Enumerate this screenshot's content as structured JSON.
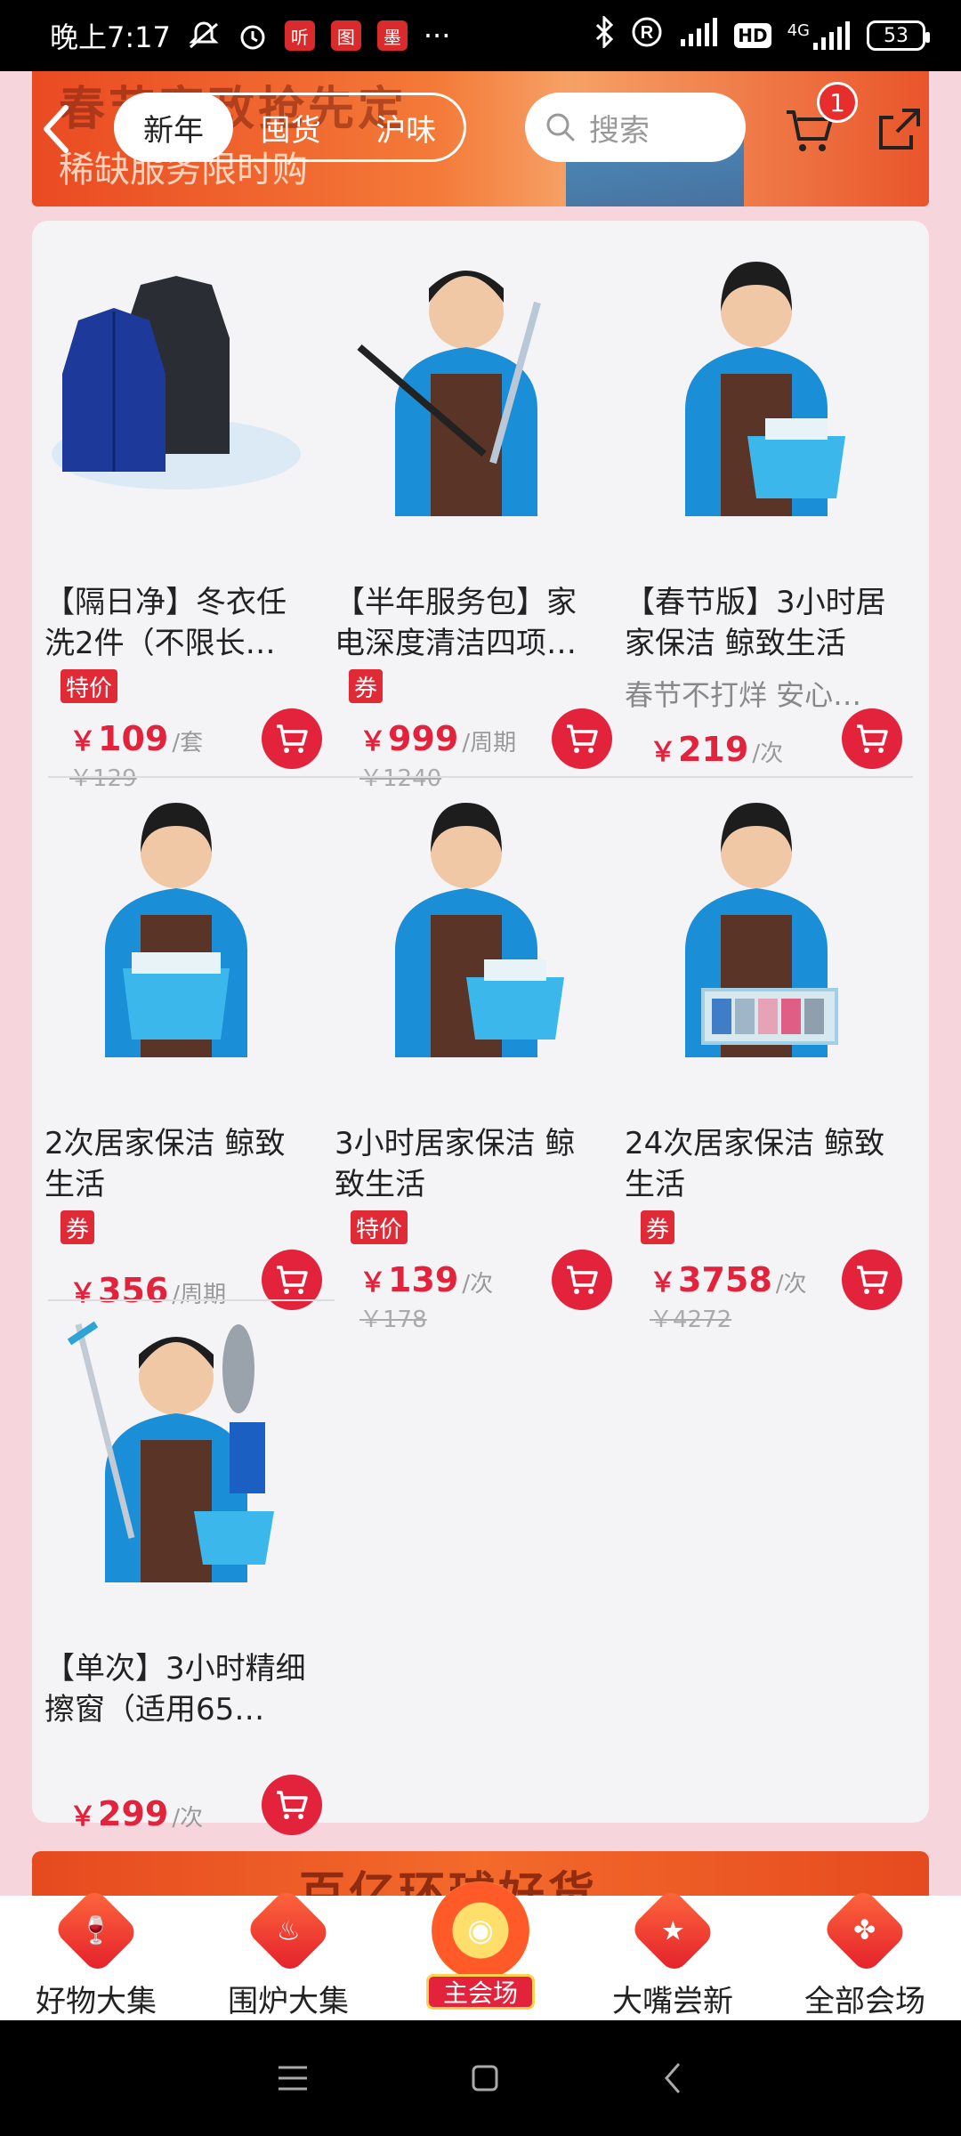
{
  "status_bar": {
    "time": "晚上7:17",
    "more": "···",
    "network": "4G",
    "hd": "HD",
    "battery": "53",
    "app_icons": [
      "听",
      "图",
      "墨"
    ]
  },
  "header": {
    "banner_title": "春节家政抢先定",
    "banner_subtitle": "稀缺服务限时购",
    "tabs": [
      "新年",
      "囤货",
      "沪味"
    ],
    "search_placeholder": "搜索",
    "cart_badge": "1"
  },
  "products": [
    {
      "name": "【隔日净】冬衣任洗2件（不限长…",
      "tag": "特价",
      "price": "109",
      "unit": "/套",
      "original": "￥129",
      "subline": ""
    },
    {
      "name": "【半年服务包】家电深度清洁四项…",
      "tag": "券",
      "price": "999",
      "unit": "/周期",
      "original": "￥1240",
      "subline": ""
    },
    {
      "name": "【春节版】3小时居家保洁 鲸致生活",
      "tag": "",
      "price": "219",
      "unit": "/次",
      "original": "",
      "subline": "春节不打烊 安心…"
    },
    {
      "name": "2次居家保洁 鲸致生活",
      "tag": "券",
      "price": "356",
      "unit": "/周期",
      "original": "",
      "subline": ""
    },
    {
      "name": "3小时居家保洁 鲸致生活",
      "tag": "特价",
      "price": "139",
      "unit": "/次",
      "original": "￥178",
      "subline": ""
    },
    {
      "name": "24次居家保洁 鲸致生活",
      "tag": "券",
      "price": "3758",
      "unit": "/次",
      "original": "￥4272",
      "subline": ""
    },
    {
      "name": "【单次】3小时精细擦窗（适用65…",
      "tag": "",
      "price": "299",
      "unit": "/次",
      "original": "",
      "subline": ""
    }
  ],
  "currency": "￥",
  "promo_strip_text": "百亿环球好货",
  "bottom_nav": [
    {
      "label": "好物大集",
      "icon": "wine-glass-icon"
    },
    {
      "label": "围炉大集",
      "icon": "hotpot-icon"
    },
    {
      "label": "主会场",
      "icon": "main-venue-icon"
    },
    {
      "label": "大嘴尝新",
      "icon": "star-icon"
    },
    {
      "label": "全部会场",
      "icon": "clover-icon"
    }
  ],
  "colors": {
    "accent": "#e2233b",
    "banner": "#ea4a22",
    "background": "#f6d6dc"
  }
}
